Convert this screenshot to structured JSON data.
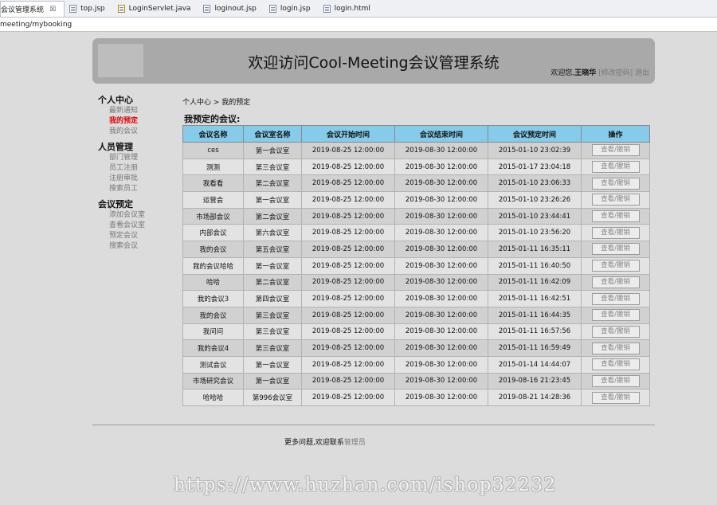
{
  "editor": {
    "tabs": [
      {
        "label": "会议管理系统",
        "close": "☒",
        "active": true
      },
      {
        "label": "top.jsp"
      },
      {
        "label": "LoginServlet.java"
      },
      {
        "label": "loginout.jsp"
      },
      {
        "label": "login.jsp"
      },
      {
        "label": "login.html"
      }
    ],
    "url": "meeting/mybooking"
  },
  "header": {
    "title": "欢迎访问Cool-Meeting会议管理系统",
    "welcome_prefix": "欢迎您,",
    "username": "王晓华",
    "change_password": "[修改密码]",
    "logout": "退出"
  },
  "nav": [
    {
      "group": "个人中心",
      "items": [
        {
          "label": "最新通知"
        },
        {
          "label": "我的预定",
          "current": true
        },
        {
          "label": "我的会议"
        }
      ]
    },
    {
      "group": "人员管理",
      "items": [
        {
          "label": "部门管理"
        },
        {
          "label": "员工注册"
        },
        {
          "label": "注册审批"
        },
        {
          "label": "搜索员工"
        }
      ]
    },
    {
      "group": "会议预定",
      "items": [
        {
          "label": "添加会议室"
        },
        {
          "label": "查看会议室"
        },
        {
          "label": "预定会议"
        },
        {
          "label": "搜索会议"
        }
      ]
    }
  ],
  "breadcrumb": "个人中心 > 我的预定",
  "section_title": "我预定的会议:",
  "table": {
    "headers": [
      "会议名称",
      "会议室名称",
      "会议开始时间",
      "会议结束时间",
      "会议预定时间",
      "操作"
    ],
    "action_label": "查看/撤销",
    "rows": [
      [
        "ces",
        "第一会议室",
        "2019-08-25 12:00:00",
        "2019-08-30 12:00:00",
        "2015-01-10 23:02:39"
      ],
      [
        "测测",
        "第三会议室",
        "2019-08-25 12:00:00",
        "2019-08-30 12:00:00",
        "2015-01-17 23:04:18"
      ],
      [
        "我看看",
        "第二会议室",
        "2019-08-25 12:00:00",
        "2019-08-30 12:00:00",
        "2015-01-10 23:06:33"
      ],
      [
        "运营会",
        "第一会议室",
        "2019-08-25 12:00:00",
        "2019-08-30 12:00:00",
        "2015-01-10 23:26:26"
      ],
      [
        "市场部会议",
        "第二会议室",
        "2019-08-25 12:00:00",
        "2019-08-30 12:00:00",
        "2015-01-10 23:44:41"
      ],
      [
        "内部会议",
        "第六会议室",
        "2019-08-25 12:00:00",
        "2019-08-30 12:00:00",
        "2015-01-10 23:56:20"
      ],
      [
        "我的会议",
        "第五会议室",
        "2019-08-25 12:00:00",
        "2019-08-30 12:00:00",
        "2015-01-11 16:35:11"
      ],
      [
        "我的会议哈哈",
        "第一会议室",
        "2019-08-25 12:00:00",
        "2019-08-30 12:00:00",
        "2015-01-11 16:40:50"
      ],
      [
        "哈哈",
        "第二会议室",
        "2019-08-25 12:00:00",
        "2019-08-30 12:00:00",
        "2015-01-11 16:42:09"
      ],
      [
        "我的会议3",
        "第四会议室",
        "2019-08-25 12:00:00",
        "2019-08-30 12:00:00",
        "2015-01-11 16:42:51"
      ],
      [
        "我的会议",
        "第三会议室",
        "2019-08-25 12:00:00",
        "2019-08-30 12:00:00",
        "2015-01-11 16:44:35"
      ],
      [
        "我问问",
        "第三会议室",
        "2019-08-25 12:00:00",
        "2019-08-30 12:00:00",
        "2015-01-11 16:57:56"
      ],
      [
        "我的会议4",
        "第三会议室",
        "2019-08-25 12:00:00",
        "2019-08-30 12:00:00",
        "2015-01-11 16:59:49"
      ],
      [
        "测试会议",
        "第一会议室",
        "2019-08-25 12:00:00",
        "2019-08-30 12:00:00",
        "2015-01-14 14:44:07"
      ],
      [
        "市场研究会议",
        "第一会议室",
        "2019-08-25 12:00:00",
        "2019-08-30 12:00:00",
        "2019-08-16 21:23:45"
      ],
      [
        "哈哈哈",
        "第996会议室",
        "2019-08-25 12:00:00",
        "2019-08-30 12:00:00",
        "2019-08-21 14:28:36"
      ]
    ]
  },
  "footer": {
    "text": "更多问题,欢迎联系",
    "link": "管理员"
  },
  "watermark": "https://www.huzhan.com/ishop32232"
}
